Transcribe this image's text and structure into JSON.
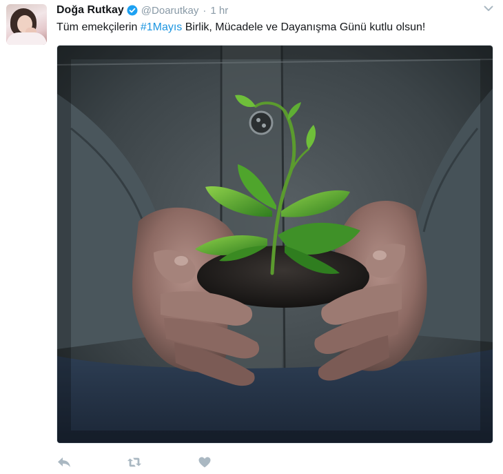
{
  "tweet": {
    "user": {
      "display_name": "Doğa Rutkay",
      "screen_name": "@Doarutkay",
      "verified": true
    },
    "separator": "·",
    "time": "1 hr",
    "text": {
      "before": "Tüm emekçilerin ",
      "hashtag": "#1Mayıs",
      "after": " Birlik, Mücadele ve Dayanışma Günü kutlu olsun!"
    },
    "actions": [
      "reply-icon",
      "retweet-icon",
      "like-icon"
    ],
    "colors": {
      "text": "#14171a",
      "muted": "#8899a6",
      "link": "#1b95e0",
      "verified": "#1da1f2",
      "action": "#aab8c2"
    }
  }
}
